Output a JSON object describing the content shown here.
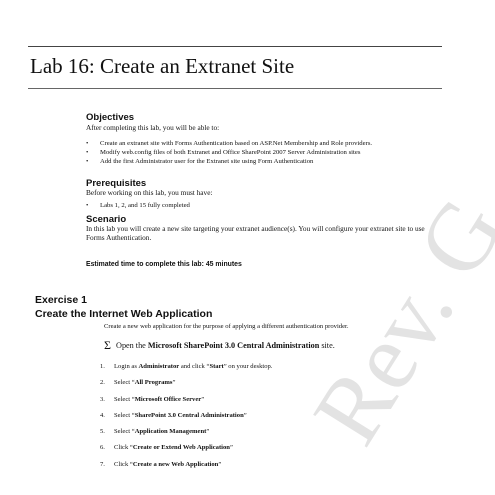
{
  "lab_title": "Lab 16: Create an Extranet Site",
  "watermark": "Rev. G",
  "objectives": {
    "heading": "Objectives",
    "intro": "After completing this lab, you will be able to:",
    "items": [
      "Create an extranet site with Forms Authentication based on ASP.Net Membership and Role providers.",
      "Modify web.config files of both Extranet and Office SharePoint 2007 Server Administration sites",
      "Add the first Administrator user for the Extranet site using Form Authentication"
    ]
  },
  "prerequisites": {
    "heading": "Prerequisites",
    "intro": "Before working on this lab, you must have:",
    "items": [
      "Labs 1, 2, and 15 fully completed"
    ]
  },
  "scenario": {
    "heading": "Scenario",
    "text": "In this lab you will create a new site targeting your extranet audience(s). You will configure your extranet site to use Forms Authentication."
  },
  "estimated_time": "Estimated time to complete this lab: 45 minutes",
  "exercise": {
    "number": "Exercise 1",
    "title": "Create the Internet Web Application",
    "intro": "Create a new web application for the purpose of applying a different authentication provider.",
    "sigma_step": {
      "symbol": "Σ",
      "prefix": "Open the",
      "bold": "Microsoft SharePoint 3.0 Central Administration",
      "suffix": "site."
    },
    "steps": [
      {
        "num": "1.",
        "pre": "Login as ",
        "bold": "Administrator",
        "mid": " and click “",
        "bold2": "Start",
        "post": "” on your desktop."
      },
      {
        "num": "2.",
        "pre": "Select “",
        "bold": "All Programs",
        "post": "”"
      },
      {
        "num": "3.",
        "pre": "Select “",
        "bold": "Microsoft Office Server",
        "post": "”"
      },
      {
        "num": "4.",
        "pre": "Select “",
        "bold": "SharePoint 3.0 Central Administration",
        "post": "”"
      },
      {
        "num": "5.",
        "pre": "Select “",
        "bold": "Application Management",
        "post": "”"
      },
      {
        "num": "6.",
        "pre": "Click “",
        "bold": "Create or Extend Web Application",
        "post": "”"
      },
      {
        "num": "7.",
        "pre": "Click “",
        "bold": "Create a new Web Application",
        "post": "”"
      }
    ]
  }
}
